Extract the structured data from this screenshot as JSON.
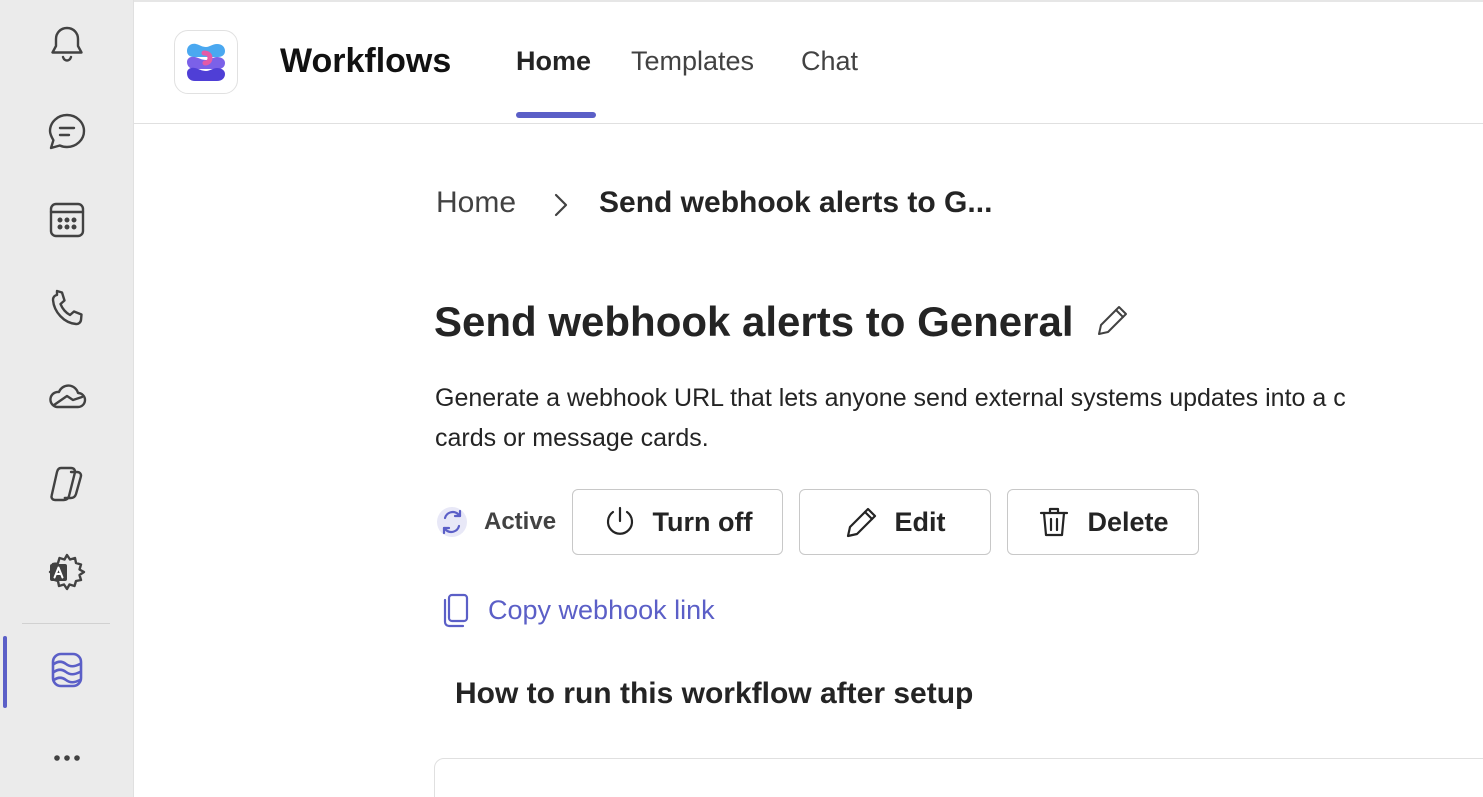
{
  "app": {
    "title": "Workflows",
    "tabs": [
      {
        "label": "Home",
        "active": true
      },
      {
        "label": "Templates",
        "active": false
      },
      {
        "label": "Chat",
        "active": false
      }
    ]
  },
  "rail": {
    "items": [
      {
        "icon": "bell-icon",
        "label": "Activity"
      },
      {
        "icon": "chat-icon",
        "label": "Chat"
      },
      {
        "icon": "calendar-icon",
        "label": "Calendar"
      },
      {
        "icon": "phone-icon",
        "label": "Calls"
      },
      {
        "icon": "cloud-icon",
        "label": "OneDrive"
      },
      {
        "icon": "copilot-icon",
        "label": "Copilot"
      },
      {
        "icon": "settings-translate-icon",
        "label": "Apps"
      },
      {
        "icon": "workflows-icon",
        "label": "Workflows",
        "active": true
      },
      {
        "icon": "more-icon",
        "label": "More"
      }
    ]
  },
  "breadcrumb": {
    "home": "Home",
    "current": "Send webhook alerts to G..."
  },
  "workflow": {
    "title": "Send webhook alerts to General",
    "description": "Generate a webhook URL that lets anyone send external systems updates into a c\ncards or message cards.",
    "status": "Active"
  },
  "actions": {
    "turn_off": "Turn off",
    "edit": "Edit",
    "delete": "Delete",
    "copy_link": "Copy webhook link"
  },
  "sections": {
    "how_to_run": "How to run this workflow after setup"
  },
  "colors": {
    "accent": "#5b5fc7",
    "rail_bg": "#ebebeb",
    "text": "#242424"
  }
}
